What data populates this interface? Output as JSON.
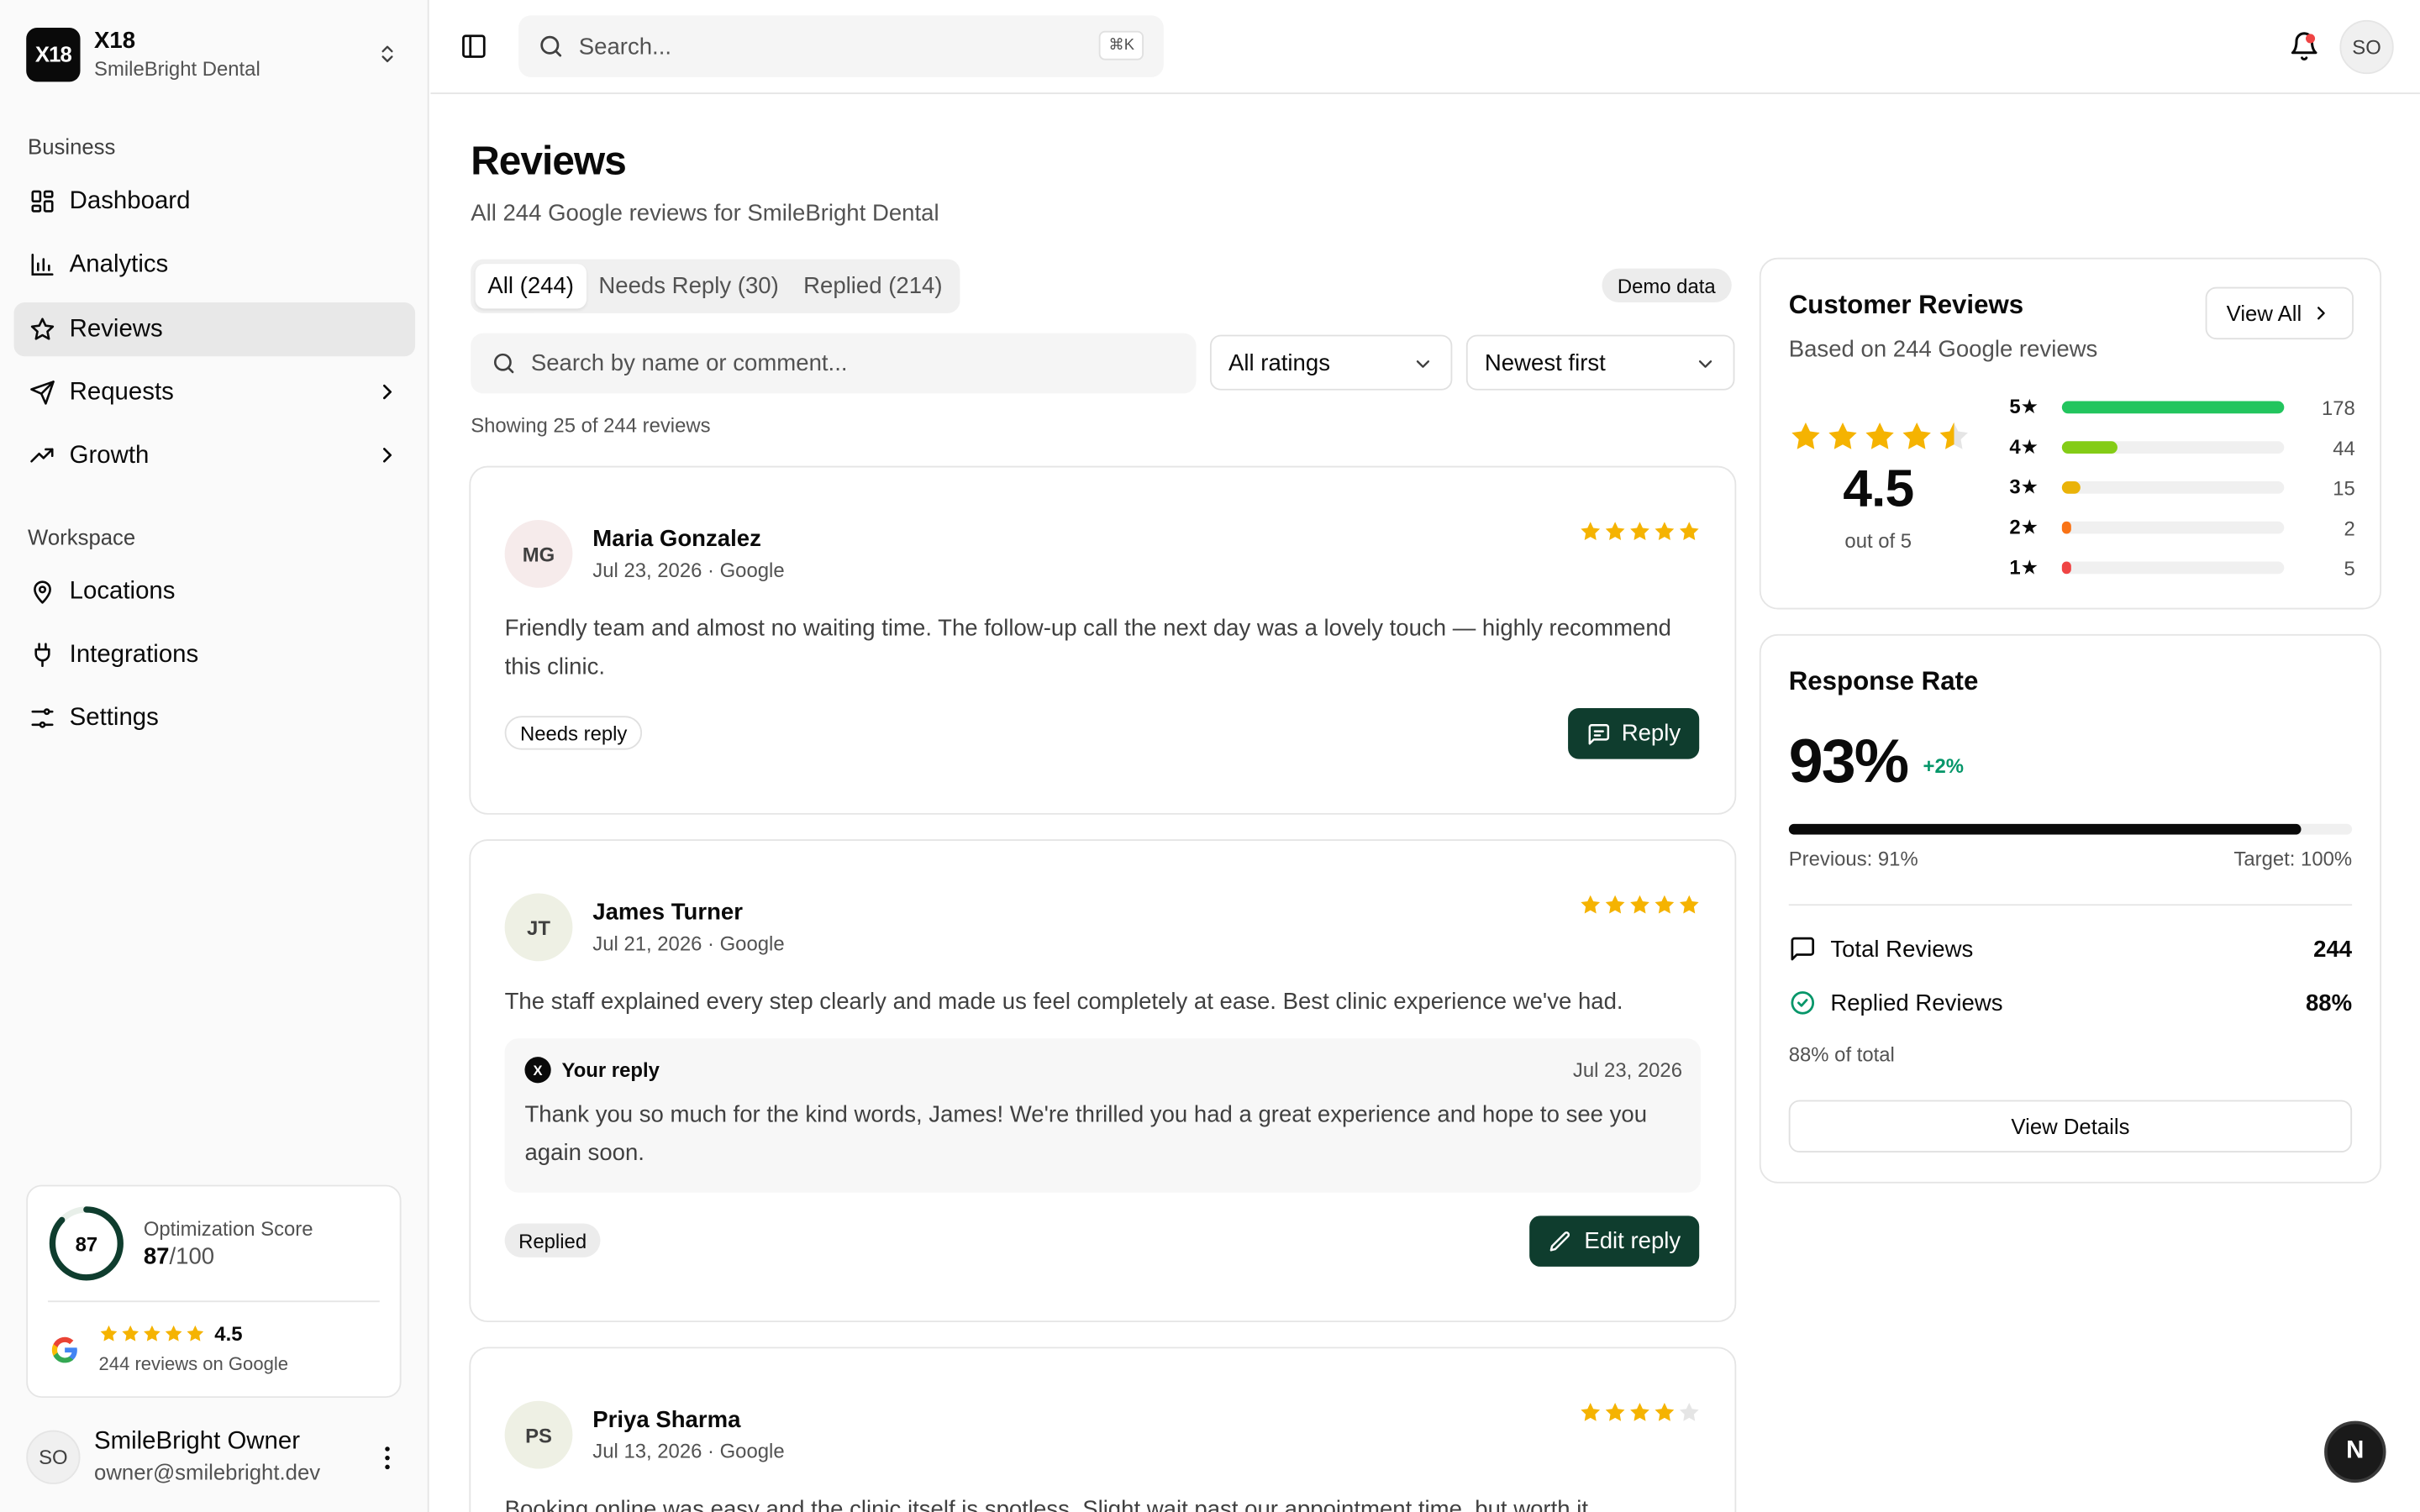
{
  "brand": {
    "logo": "X18",
    "name": "X18",
    "business": "SmileBright Dental"
  },
  "sidebar": {
    "section_business": "Business",
    "section_workspace": "Workspace",
    "items": [
      {
        "label": "Dashboard",
        "icon": "dashboard-icon"
      },
      {
        "label": "Analytics",
        "icon": "bar-chart-icon"
      },
      {
        "label": "Reviews",
        "icon": "star-icon",
        "active": true
      },
      {
        "label": "Requests",
        "icon": "send-icon",
        "has_children": true
      },
      {
        "label": "Growth",
        "icon": "trending-up-icon",
        "has_children": true
      },
      {
        "label": "Locations",
        "icon": "map-pin-icon"
      },
      {
        "label": "Integrations",
        "icon": "plug-icon"
      },
      {
        "label": "Settings",
        "icon": "sliders-icon"
      }
    ],
    "score": {
      "label": "Optimization Score",
      "value": "87",
      "max": "/100",
      "fraction": 0.87
    },
    "google": {
      "rating": "4.5",
      "sub": "244 reviews on Google"
    },
    "user": {
      "initials": "SO",
      "name": "SmileBright Owner",
      "email": "owner@smilebright.dev"
    }
  },
  "topbar": {
    "search_placeholder": "Search...",
    "shortcut": "⌘K",
    "avatar": "SO"
  },
  "page": {
    "title": "Reviews",
    "subtitle": "All 244 Google reviews for SmileBright Dental",
    "tabs": [
      {
        "label": "All (244)",
        "active": true
      },
      {
        "label": "Needs Reply (30)"
      },
      {
        "label": "Replied (214)"
      }
    ],
    "demo_badge": "Demo data",
    "filter_placeholder": "Search by name or comment...",
    "rating_filter": "All ratings",
    "sort": "Newest first",
    "showing": "Showing 25 of 244 reviews"
  },
  "reviews": [
    {
      "initials": "MG",
      "name": "Maria Gonzalez",
      "meta": "Jul 23, 2026 · Google",
      "stars": 5,
      "text": "Friendly team and almost no waiting time. The follow-up call the next day was a lovely touch — highly recommend this clinic.",
      "status": "Needs reply",
      "action": "Reply"
    },
    {
      "initials": "JT",
      "name": "James Turner",
      "meta": "Jul 21, 2026 · Google",
      "stars": 5,
      "text": "The staff explained every step clearly and made us feel completely at ease. Best clinic experience we've had.",
      "reply_label": "Your reply",
      "reply_date": "Jul 23, 2026",
      "reply_text": "Thank you so much for the kind words, James! We're thrilled you had a great experience and hope to see you again soon.",
      "status": "Replied",
      "action": "Edit reply"
    },
    {
      "initials": "PS",
      "name": "Priya Sharma",
      "meta": "Jul 13, 2026 · Google",
      "stars": 4,
      "text": "Booking online was easy and the clinic itself is spotless. Slight wait past our appointment time, but worth it."
    }
  ],
  "customer_reviews": {
    "title": "Customer Reviews",
    "subtitle": "Based on 244 Google reviews",
    "view_all": "View All",
    "rating": "4.5",
    "out_of": "out of 5",
    "distribution": [
      {
        "label": "5★",
        "count": 178,
        "color": "#22c55e"
      },
      {
        "label": "4★",
        "count": 44,
        "color": "#84cc16"
      },
      {
        "label": "3★",
        "count": 15,
        "color": "#eab308"
      },
      {
        "label": "2★",
        "count": 2,
        "color": "#f97316"
      },
      {
        "label": "1★",
        "count": 5,
        "color": "#ef4444"
      }
    ]
  },
  "response_rate": {
    "title": "Response Rate",
    "value": "93%",
    "delta": "+2%",
    "fraction": 0.91,
    "previous": "Previous: 91%",
    "target": "Target: 100%",
    "total_label": "Total Reviews",
    "total_value": "244",
    "replied_label": "Replied Reviews",
    "replied_value": "88%",
    "note": "88% of total",
    "details_btn": "View Details"
  },
  "fab": "N",
  "colors": {
    "accent": "#0f3d2e",
    "star": "#f5b301"
  }
}
